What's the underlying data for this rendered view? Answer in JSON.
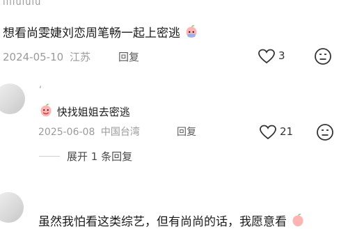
{
  "top_user": {
    "name": "illiuiuiu"
  },
  "comment": {
    "text": "想看尚雯婕刘恋周笔畅一起上密逃",
    "date": "2024-05-10",
    "location": "江苏",
    "reply_label": "回复",
    "like_count": "3"
  },
  "reply": {
    "username": "ʻ",
    "text": "快找姐姐去密逃",
    "date": "2025-06-08",
    "location": "中国台湾",
    "reply_label": "回复",
    "like_count": "21"
  },
  "expand": {
    "label": "展开 1 条回复"
  },
  "next_comment": {
    "text": "虽然我怕看这类综艺，但有尚尚的话，我愿意看"
  },
  "colors": {
    "accent": "#ff6b7d",
    "muted": "#9a9a9a"
  },
  "icons": {
    "like": "heart-icon",
    "dislike": "meh-face-icon",
    "emoji": "peach-emoji-icon"
  }
}
